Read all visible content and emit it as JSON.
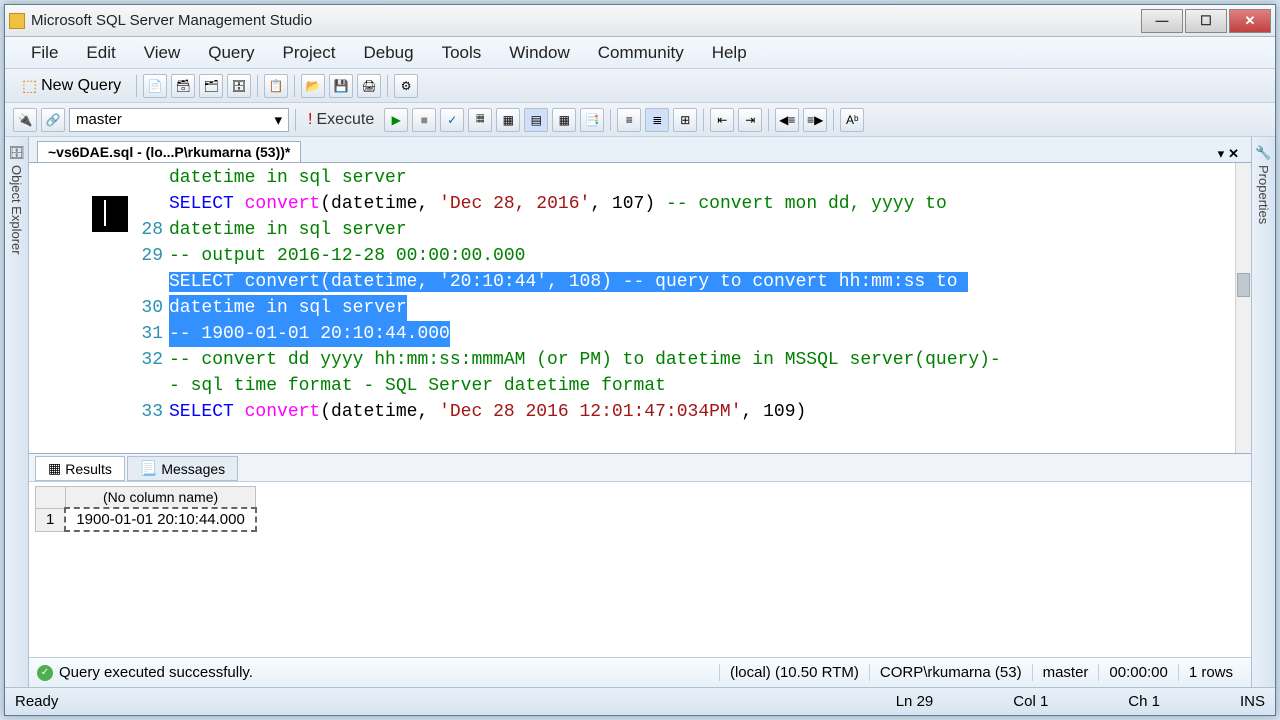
{
  "window": {
    "title": "Microsoft SQL Server Management Studio"
  },
  "menu": [
    "File",
    "Edit",
    "View",
    "Query",
    "Project",
    "Debug",
    "Tools",
    "Window",
    "Community",
    "Help"
  ],
  "toolbar": {
    "new_query": "New Query"
  },
  "db": {
    "selected": "master"
  },
  "execute": {
    "label": "Execute"
  },
  "side": {
    "left": "Object Explorer",
    "right": "Properties"
  },
  "doc_tab": "~vs6DAE.sql - (lo...P\\rkumarna (53))*",
  "editor": {
    "line_numbers": [
      "",
      "",
      "28",
      "29",
      "",
      "30",
      "31",
      "32",
      "",
      "33"
    ],
    "lines": [
      {
        "segments": [
          {
            "t": "datetime in sql server",
            "cls": "cmt"
          }
        ]
      },
      {
        "segments": [
          {
            "t": "SELECT ",
            "cls": "kw"
          },
          {
            "t": "convert",
            "cls": "fn"
          },
          {
            "t": "(datetime, ",
            "cls": ""
          },
          {
            "t": "'Dec 28, 2016'",
            "cls": "str"
          },
          {
            "t": ", 107) ",
            "cls": ""
          },
          {
            "t": "-- convert mon dd, yyyy to",
            "cls": "cmt"
          }
        ]
      },
      {
        "segments": [
          {
            "t": "datetime in sql server",
            "cls": "cmt"
          }
        ]
      },
      {
        "segments": [
          {
            "t": "-- output 2016-12-28 00:00:00.000",
            "cls": "cmt"
          }
        ]
      },
      {
        "sel": true,
        "segments": [
          {
            "t": "SELECT ",
            "cls": "kw"
          },
          {
            "t": "convert",
            "cls": "fn"
          },
          {
            "t": "(datetime, ",
            "cls": ""
          },
          {
            "t": "'20:10:44'",
            "cls": "str"
          },
          {
            "t": ", 108) ",
            "cls": ""
          },
          {
            "t": "-- query to convert hh:mm:ss to ",
            "cls": "cmt"
          }
        ]
      },
      {
        "sel": true,
        "half": true,
        "segments": [
          {
            "t": "datetime in sql server",
            "cls": "cmt"
          }
        ]
      },
      {
        "sel": true,
        "half2": true,
        "segments": [
          {
            "t": "-- 1900-01-01 20:10:44.000",
            "cls": "cmt"
          }
        ]
      },
      {
        "segments": [
          {
            "t": "",
            "cls": ""
          }
        ]
      },
      {
        "segments": [
          {
            "t": "-- convert dd yyyy hh:mm:ss:mmmAM (or PM) to datetime in MSSQL server(query)-",
            "cls": "cmt"
          }
        ]
      },
      {
        "segments": [
          {
            "t": "- sql time format - SQL Server datetime format",
            "cls": "cmt"
          }
        ]
      },
      {
        "segments": [
          {
            "t": "SELECT ",
            "cls": "kw"
          },
          {
            "t": "convert",
            "cls": "fn"
          },
          {
            "t": "(datetime, ",
            "cls": ""
          },
          {
            "t": "'Dec 28 2016 12:01:47:034PM'",
            "cls": "str"
          },
          {
            "t": ", 109)",
            "cls": ""
          }
        ]
      }
    ]
  },
  "results": {
    "tabs": {
      "results": "Results",
      "messages": "Messages"
    },
    "header": "(No column name)",
    "rows": [
      {
        "n": "1",
        "v": "1900-01-01 20:10:44.000"
      }
    ]
  },
  "qstatus": {
    "msg": "Query executed successfully.",
    "server": "(local) (10.50 RTM)",
    "user": "CORP\\rkumarna (53)",
    "db": "master",
    "time": "00:00:00",
    "rows": "1 rows"
  },
  "status": {
    "ready": "Ready",
    "ln": "Ln 29",
    "col": "Col 1",
    "ch": "Ch 1",
    "ins": "INS"
  }
}
